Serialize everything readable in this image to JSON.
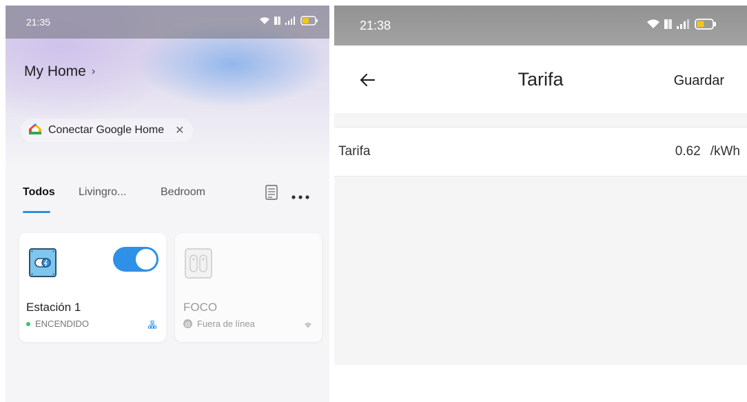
{
  "left": {
    "status_bar": {
      "time": "21:35",
      "icons": [
        "wifi-icon",
        "volte-icon",
        "signal-icon",
        "battery-icon"
      ]
    },
    "home": {
      "title": "My Home",
      "chevron": "›"
    },
    "google_chip": {
      "label": "Conectar Google Home",
      "close": "✕",
      "icon": "google-home-icon"
    },
    "tabs": [
      {
        "label": "Todos",
        "active": true
      },
      {
        "label": "Livingro...",
        "active": false
      },
      {
        "label": "Bedroom",
        "active": false
      }
    ],
    "tab_icons": [
      "list-view-icon",
      "more-dots-icon"
    ],
    "devices": [
      {
        "name": "Estación 1",
        "status": "ENCENDIDO",
        "online": true,
        "toggle_on": true,
        "icon": "power-station-icon",
        "corner_icon": "network-hub-icon"
      },
      {
        "name": "FOCO",
        "status": "Fuera de línea",
        "online": false,
        "icon": "switch-plate-icon",
        "corner_icon": "wifi-faded-icon"
      }
    ]
  },
  "right": {
    "status_bar": {
      "time": "21:38",
      "icons": [
        "wifi-icon",
        "volte-icon",
        "signal-icon",
        "battery-icon"
      ]
    },
    "app_bar": {
      "back_icon": "arrow-left-icon",
      "title": "Tarifa",
      "save_label": "Guardar"
    },
    "tariff": {
      "label": "Tarifa",
      "value": "0.62",
      "unit": "/kWh"
    }
  },
  "colors": {
    "accent_blue": "#2e90e6",
    "online_green": "#39c46b",
    "battery_yellow": "#f3c520"
  }
}
